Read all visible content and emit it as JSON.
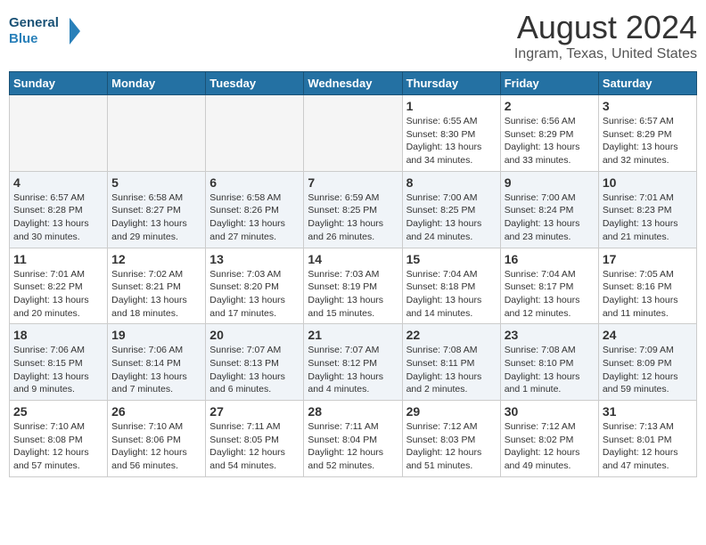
{
  "header": {
    "logo_line1": "General",
    "logo_line2": "Blue",
    "title": "August 2024",
    "subtitle": "Ingram, Texas, United States"
  },
  "calendar": {
    "days_of_week": [
      "Sunday",
      "Monday",
      "Tuesday",
      "Wednesday",
      "Thursday",
      "Friday",
      "Saturday"
    ],
    "weeks": [
      {
        "cells": [
          {
            "date": "",
            "info": "",
            "empty": true
          },
          {
            "date": "",
            "info": "",
            "empty": true
          },
          {
            "date": "",
            "info": "",
            "empty": true
          },
          {
            "date": "",
            "info": "",
            "empty": true
          },
          {
            "date": "1",
            "info": "Sunrise: 6:55 AM\nSunset: 8:30 PM\nDaylight: 13 hours\nand 34 minutes."
          },
          {
            "date": "2",
            "info": "Sunrise: 6:56 AM\nSunset: 8:29 PM\nDaylight: 13 hours\nand 33 minutes."
          },
          {
            "date": "3",
            "info": "Sunrise: 6:57 AM\nSunset: 8:29 PM\nDaylight: 13 hours\nand 32 minutes."
          }
        ]
      },
      {
        "cells": [
          {
            "date": "4",
            "info": "Sunrise: 6:57 AM\nSunset: 8:28 PM\nDaylight: 13 hours\nand 30 minutes."
          },
          {
            "date": "5",
            "info": "Sunrise: 6:58 AM\nSunset: 8:27 PM\nDaylight: 13 hours\nand 29 minutes."
          },
          {
            "date": "6",
            "info": "Sunrise: 6:58 AM\nSunset: 8:26 PM\nDaylight: 13 hours\nand 27 minutes."
          },
          {
            "date": "7",
            "info": "Sunrise: 6:59 AM\nSunset: 8:25 PM\nDaylight: 13 hours\nand 26 minutes."
          },
          {
            "date": "8",
            "info": "Sunrise: 7:00 AM\nSunset: 8:25 PM\nDaylight: 13 hours\nand 24 minutes."
          },
          {
            "date": "9",
            "info": "Sunrise: 7:00 AM\nSunset: 8:24 PM\nDaylight: 13 hours\nand 23 minutes."
          },
          {
            "date": "10",
            "info": "Sunrise: 7:01 AM\nSunset: 8:23 PM\nDaylight: 13 hours\nand 21 minutes."
          }
        ]
      },
      {
        "cells": [
          {
            "date": "11",
            "info": "Sunrise: 7:01 AM\nSunset: 8:22 PM\nDaylight: 13 hours\nand 20 minutes."
          },
          {
            "date": "12",
            "info": "Sunrise: 7:02 AM\nSunset: 8:21 PM\nDaylight: 13 hours\nand 18 minutes."
          },
          {
            "date": "13",
            "info": "Sunrise: 7:03 AM\nSunset: 8:20 PM\nDaylight: 13 hours\nand 17 minutes."
          },
          {
            "date": "14",
            "info": "Sunrise: 7:03 AM\nSunset: 8:19 PM\nDaylight: 13 hours\nand 15 minutes."
          },
          {
            "date": "15",
            "info": "Sunrise: 7:04 AM\nSunset: 8:18 PM\nDaylight: 13 hours\nand 14 minutes."
          },
          {
            "date": "16",
            "info": "Sunrise: 7:04 AM\nSunset: 8:17 PM\nDaylight: 13 hours\nand 12 minutes."
          },
          {
            "date": "17",
            "info": "Sunrise: 7:05 AM\nSunset: 8:16 PM\nDaylight: 13 hours\nand 11 minutes."
          }
        ]
      },
      {
        "cells": [
          {
            "date": "18",
            "info": "Sunrise: 7:06 AM\nSunset: 8:15 PM\nDaylight: 13 hours\nand 9 minutes."
          },
          {
            "date": "19",
            "info": "Sunrise: 7:06 AM\nSunset: 8:14 PM\nDaylight: 13 hours\nand 7 minutes."
          },
          {
            "date": "20",
            "info": "Sunrise: 7:07 AM\nSunset: 8:13 PM\nDaylight: 13 hours\nand 6 minutes."
          },
          {
            "date": "21",
            "info": "Sunrise: 7:07 AM\nSunset: 8:12 PM\nDaylight: 13 hours\nand 4 minutes."
          },
          {
            "date": "22",
            "info": "Sunrise: 7:08 AM\nSunset: 8:11 PM\nDaylight: 13 hours\nand 2 minutes."
          },
          {
            "date": "23",
            "info": "Sunrise: 7:08 AM\nSunset: 8:10 PM\nDaylight: 13 hours\nand 1 minute."
          },
          {
            "date": "24",
            "info": "Sunrise: 7:09 AM\nSunset: 8:09 PM\nDaylight: 12 hours\nand 59 minutes."
          }
        ]
      },
      {
        "cells": [
          {
            "date": "25",
            "info": "Sunrise: 7:10 AM\nSunset: 8:08 PM\nDaylight: 12 hours\nand 57 minutes."
          },
          {
            "date": "26",
            "info": "Sunrise: 7:10 AM\nSunset: 8:06 PM\nDaylight: 12 hours\nand 56 minutes."
          },
          {
            "date": "27",
            "info": "Sunrise: 7:11 AM\nSunset: 8:05 PM\nDaylight: 12 hours\nand 54 minutes."
          },
          {
            "date": "28",
            "info": "Sunrise: 7:11 AM\nSunset: 8:04 PM\nDaylight: 12 hours\nand 52 minutes."
          },
          {
            "date": "29",
            "info": "Sunrise: 7:12 AM\nSunset: 8:03 PM\nDaylight: 12 hours\nand 51 minutes."
          },
          {
            "date": "30",
            "info": "Sunrise: 7:12 AM\nSunset: 8:02 PM\nDaylight: 12 hours\nand 49 minutes."
          },
          {
            "date": "31",
            "info": "Sunrise: 7:13 AM\nSunset: 8:01 PM\nDaylight: 12 hours\nand 47 minutes."
          }
        ]
      }
    ]
  }
}
